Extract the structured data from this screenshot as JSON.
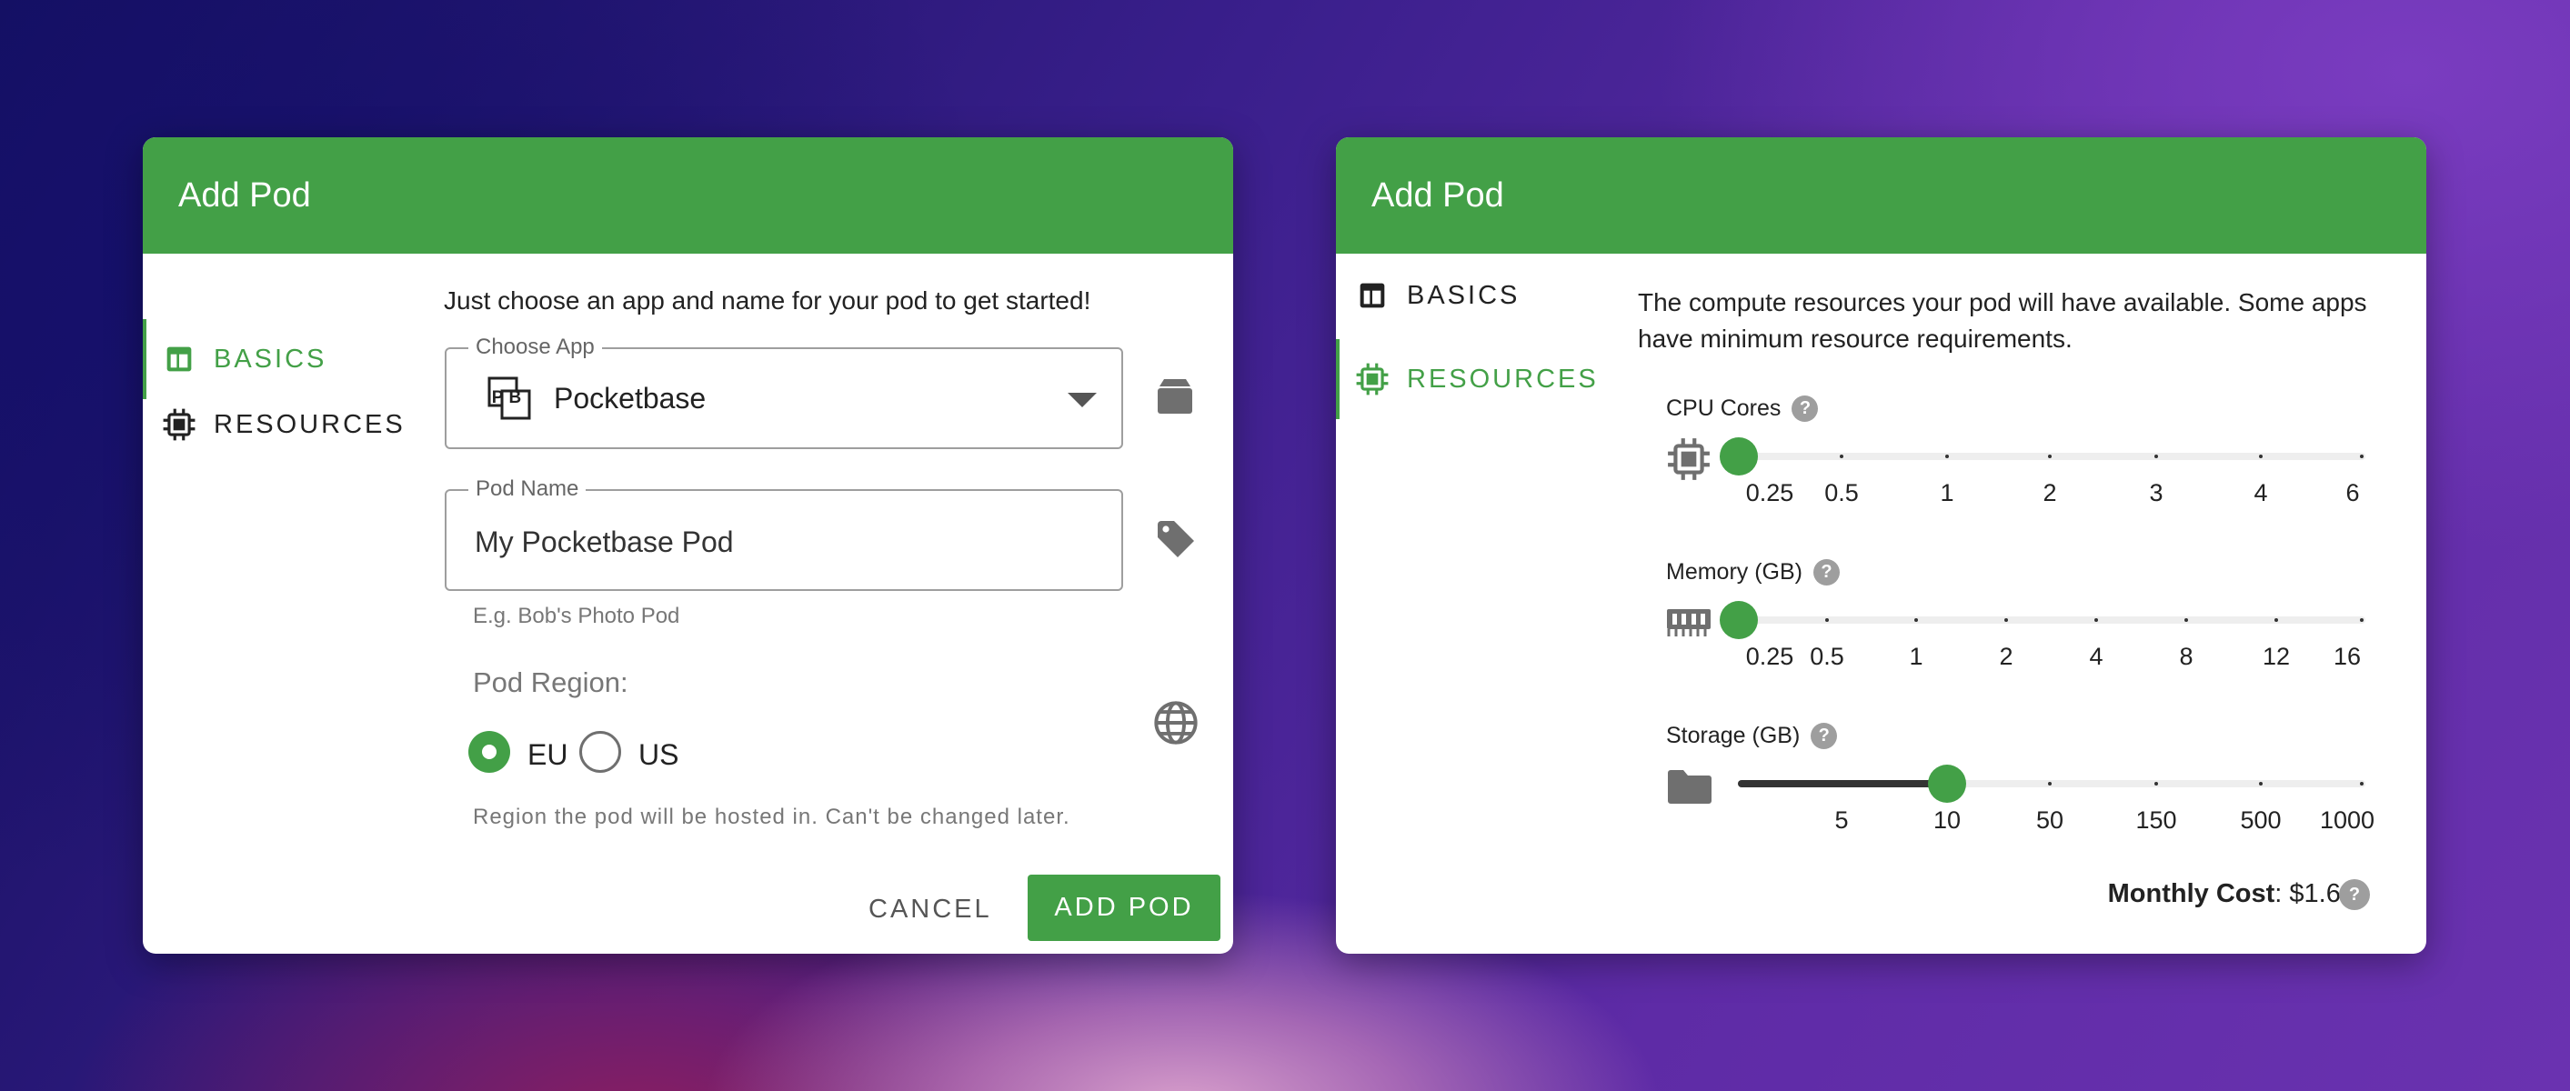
{
  "left": {
    "title": "Add Pod",
    "nav": [
      {
        "label": "BASICS"
      },
      {
        "label": "RESOURCES"
      }
    ],
    "intro": "Just choose an app and name for your pod to get started!",
    "choose_app": {
      "label": "Choose App",
      "value": "Pocketbase",
      "logo": "PB"
    },
    "pod_name": {
      "label": "Pod Name",
      "value": "My Pocketbase Pod",
      "helper": "E.g. Bob's Photo Pod"
    },
    "region": {
      "label": "Pod Region:",
      "options": [
        "EU",
        "US"
      ],
      "selected": "EU",
      "helper": "Region the pod will be hosted in. Can't be changed later."
    },
    "cancel_label": "CANCEL",
    "add_label": "ADD POD"
  },
  "right": {
    "title": "Add Pod",
    "nav": [
      {
        "label": "BASICS"
      },
      {
        "label": "RESOURCES"
      }
    ],
    "intro": "The compute resources your pod will have available. Some apps have minimum resource requirements.",
    "cpu": {
      "label": "CPU Cores",
      "help": "?",
      "ticks": [
        "0.25",
        "0.5",
        "1",
        "2",
        "3",
        "4",
        "6"
      ],
      "value": "0.25"
    },
    "memory": {
      "label": "Memory (GB)",
      "help": "?",
      "ticks": [
        "0.25",
        "0.5",
        "1",
        "2",
        "4",
        "8",
        "12",
        "16"
      ],
      "value": "0.25"
    },
    "storage": {
      "label": "Storage (GB)",
      "help": "?",
      "ticks": [
        "5",
        "10",
        "50",
        "150",
        "500",
        "1000"
      ],
      "value": "10"
    },
    "cost": {
      "label": "Monthly Cost",
      "value": "$1.60",
      "help": "?"
    }
  },
  "colors": {
    "accent": "#43a047"
  }
}
